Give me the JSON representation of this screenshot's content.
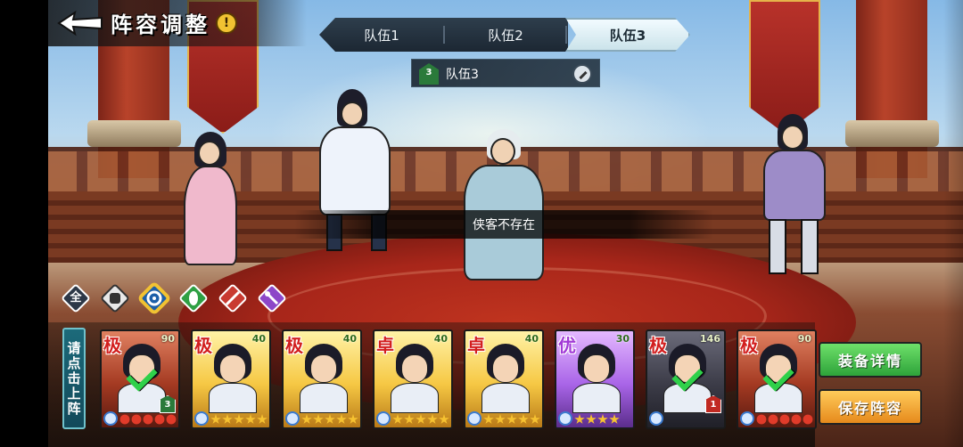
{
  "header": {
    "title": "阵容调整",
    "warn_glyph": "!"
  },
  "tabs": [
    {
      "label": "队伍1",
      "active": false
    },
    {
      "label": "队伍2",
      "active": false
    },
    {
      "label": "队伍3",
      "active": true
    }
  ],
  "team_bar": {
    "flag_number": "3",
    "name": "队伍3"
  },
  "toast": "侠客不存在",
  "filters": [
    {
      "icon": "all-filter-icon",
      "glyph": "全"
    },
    {
      "icon": "fist-filter-icon",
      "glyph": ""
    },
    {
      "icon": "swirl-filter-icon",
      "glyph": "",
      "selected": true
    },
    {
      "icon": "leaf-filter-icon",
      "glyph": ""
    },
    {
      "icon": "sword-filter-icon",
      "glyph": ""
    },
    {
      "icon": "staff-filter-icon",
      "glyph": ""
    }
  ],
  "deploy_panel": "请点击上阵",
  "roster": [
    {
      "rank": "极",
      "level": "90",
      "style": "red",
      "stars": 5,
      "star_type": "red",
      "deployed": true,
      "badge": "3",
      "badge_color": "green"
    },
    {
      "rank": "极",
      "level": "40",
      "style": "gold",
      "stars": 5,
      "star_type": "gold",
      "deployed": false
    },
    {
      "rank": "极",
      "level": "40",
      "style": "gold",
      "stars": 5,
      "star_type": "gold",
      "deployed": false
    },
    {
      "rank": "卓",
      "level": "40",
      "style": "gold",
      "stars": 5,
      "star_type": "gold",
      "deployed": false
    },
    {
      "rank": "卓",
      "level": "40",
      "style": "gold",
      "stars": 5,
      "star_type": "gold",
      "deployed": false
    },
    {
      "rank": "优",
      "level": "30",
      "style": "purple",
      "stars": 4,
      "star_type": "gold",
      "deployed": false
    },
    {
      "rank": "极",
      "level": "146",
      "style": "dark",
      "stars": 0,
      "star_type": "red",
      "deployed": true,
      "badge": "1",
      "badge_color": "red"
    },
    {
      "rank": "极",
      "level": "90",
      "style": "red",
      "stars": 5,
      "star_type": "red",
      "deployed": true
    }
  ],
  "buttons": {
    "equipment_details": "装备详情",
    "save_lineup": "保存阵容"
  },
  "colors": {
    "accent_green": "#2ea33a",
    "accent_orange": "#e68a1c",
    "tab_active": "#f2fbff"
  }
}
